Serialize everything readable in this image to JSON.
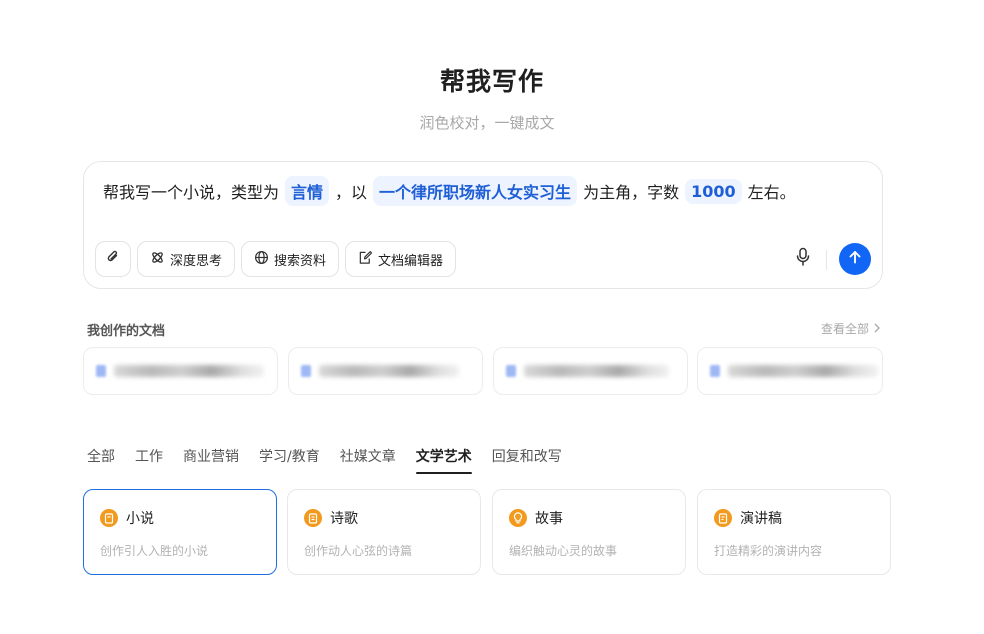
{
  "header": {
    "title": "帮我写作",
    "subtitle": "润色校对，一键成文"
  },
  "prompt": {
    "part1": "帮我写一个小说，类型为",
    "chip1": "言情",
    "part2": "，以",
    "chip2": "一个律所职场新人女实习生",
    "part3": "为主角，字数",
    "chip3": "1000",
    "part4": "左右。"
  },
  "tools": {
    "attach_icon": "paperclip-icon",
    "deep_think": "深度思考",
    "search": "搜索资料",
    "doc_editor": "文档编辑器",
    "mic_icon": "microphone-icon",
    "send_icon": "arrow-up-icon"
  },
  "docs": {
    "title": "我创作的文档",
    "view_all": "查看全部"
  },
  "tabs": [
    {
      "label": "全部"
    },
    {
      "label": "工作"
    },
    {
      "label": "商业营销"
    },
    {
      "label": "学习/教育"
    },
    {
      "label": "社媒文章"
    },
    {
      "label": "文学艺术",
      "active": true
    },
    {
      "label": "回复和改写"
    }
  ],
  "cards": [
    {
      "title": "小说",
      "desc": "创作引人入胜的小说",
      "icon": "book-icon",
      "selected": true
    },
    {
      "title": "诗歌",
      "desc": "创作动人心弦的诗篇",
      "icon": "document-icon"
    },
    {
      "title": "故事",
      "desc": "编织触动心灵的故事",
      "icon": "lightbulb-icon"
    },
    {
      "title": "演讲稿",
      "desc": "打造精彩的演讲内容",
      "icon": "notes-icon"
    }
  ],
  "colors": {
    "accent": "#1166f5",
    "chip_text": "#1f5fd6",
    "chip_bg": "#eef4ff",
    "card_icon": "#f29a1d"
  }
}
